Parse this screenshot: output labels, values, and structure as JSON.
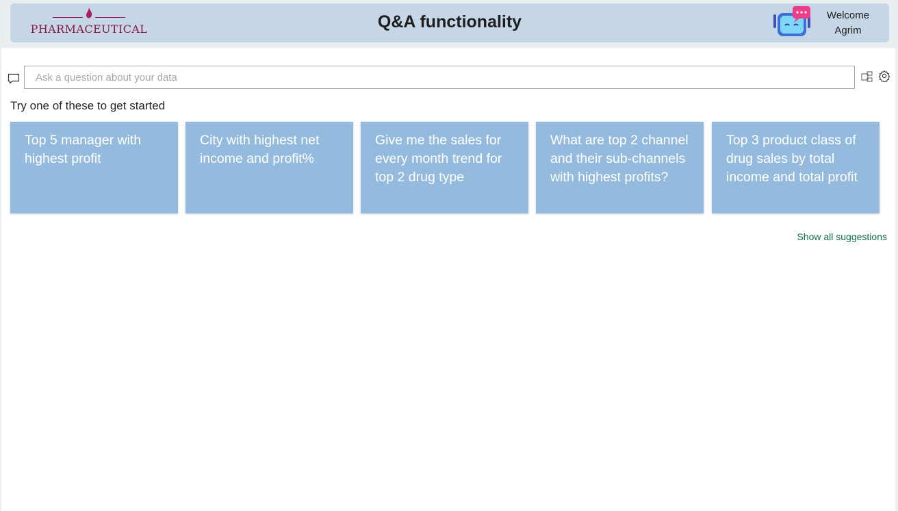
{
  "header": {
    "logo_text": "PHARMACEUTICAL",
    "title": "Q&A functionality",
    "welcome_line1": "Welcome",
    "welcome_line2": "Agrim",
    "bot_icon": "chatbot-icon"
  },
  "qa": {
    "placeholder": "Ask a question about your data",
    "value": "",
    "chat_icon": "speech-bubble-icon",
    "tools": [
      "share-diagram-icon",
      "gear-icon"
    ]
  },
  "suggestions": {
    "heading": "Try one of these to get started",
    "cards": [
      "Top 5 manager with highest profit",
      "City with highest net income and profit%",
      "Give me the sales for every month trend for top 2 drug type",
      "What are top 2 channel and their sub-channels with highest profits?",
      "Top 3 product class of drug sales by total income and total profit"
    ],
    "show_all": "Show all suggestions"
  },
  "colors": {
    "header_bg": "#c5d6e7",
    "card_bg": "#94bbdd",
    "logo": "#8b1c4a",
    "link": "#116e53"
  }
}
